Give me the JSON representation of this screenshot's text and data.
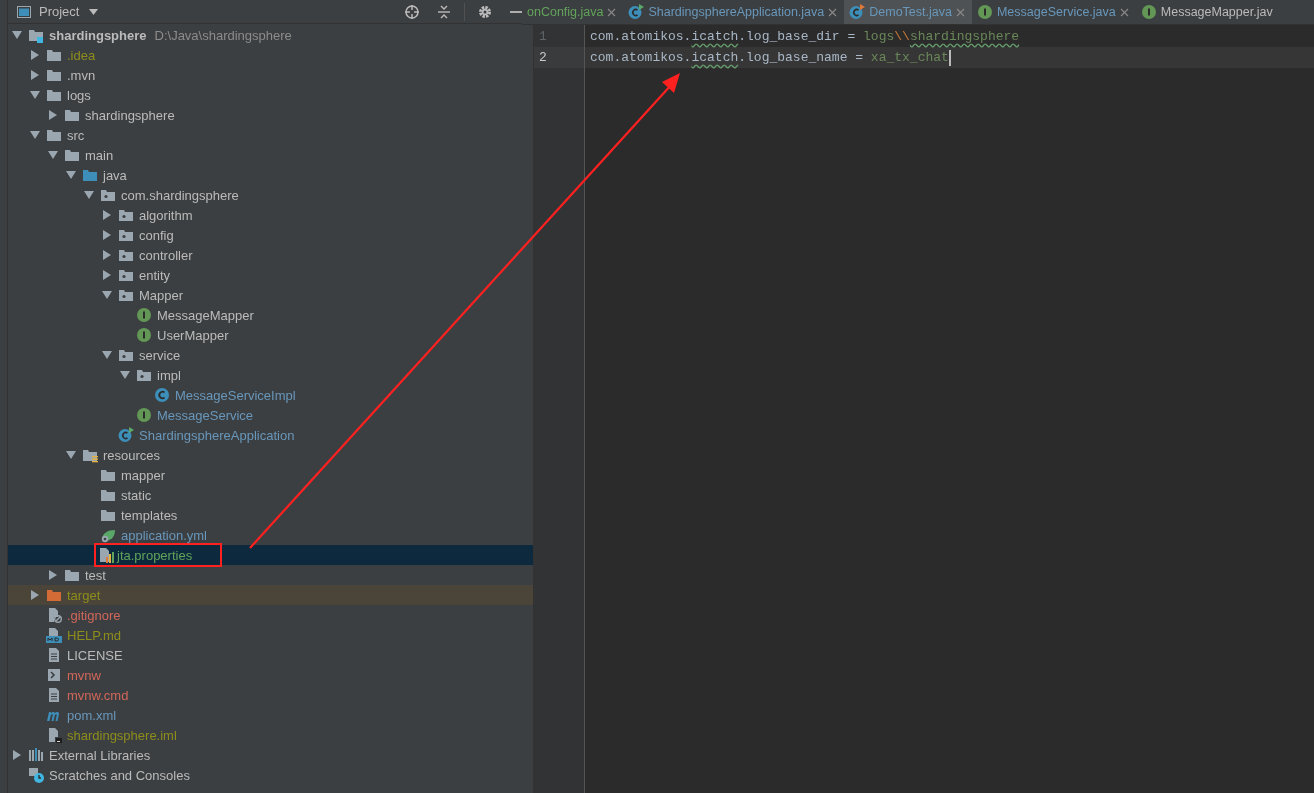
{
  "project_panel": {
    "title": "Project"
  },
  "tree": [
    {
      "name": "shardingsphere",
      "hint": "D:\\Java\\shardingsphere",
      "kind": "module",
      "color": "#bbbbbb",
      "expanded": true,
      "selected": false,
      "children": [
        {
          "name": ".idea",
          "kind": "folder",
          "color": "#8d8d1c",
          "expanded": false,
          "selected": false
        },
        {
          "name": ".mvn",
          "kind": "folder",
          "color": "#bbbbbb",
          "expanded": false,
          "selected": false
        },
        {
          "name": "logs",
          "kind": "folder",
          "color": "#bbbbbb",
          "expanded": true,
          "selected": false,
          "children": [
            {
              "name": "shardingsphere",
              "kind": "folder",
              "color": "#bbbbbb",
              "expanded": false,
              "selected": false
            }
          ]
        },
        {
          "name": "src",
          "kind": "folder",
          "color": "#bbbbbb",
          "expanded": true,
          "selected": false,
          "children": [
            {
              "name": "main",
              "kind": "folder",
              "color": "#bbbbbb",
              "expanded": true,
              "selected": false,
              "children": [
                {
                  "name": "java",
                  "kind": "source_root",
                  "color": "#bbbbbb",
                  "expanded": true,
                  "selected": false,
                  "children": [
                    {
                      "name": "com.shardingsphere",
                      "kind": "package",
                      "color": "#bbbbbb",
                      "expanded": true,
                      "selected": false,
                      "children": [
                        {
                          "name": "algorithm",
                          "kind": "package",
                          "color": "#bbbbbb",
                          "expanded": false,
                          "selected": false
                        },
                        {
                          "name": "config",
                          "kind": "package",
                          "color": "#bbbbbb",
                          "expanded": false,
                          "selected": false
                        },
                        {
                          "name": "controller",
                          "kind": "package",
                          "color": "#bbbbbb",
                          "expanded": false,
                          "selected": false
                        },
                        {
                          "name": "entity",
                          "kind": "package",
                          "color": "#bbbbbb",
                          "expanded": false,
                          "selected": false
                        },
                        {
                          "name": "Mapper",
                          "kind": "package",
                          "color": "#bbbbbb",
                          "expanded": true,
                          "selected": false,
                          "children": [
                            {
                              "name": "MessageMapper",
                              "kind": "interface",
                              "color": "#bbbbbb",
                              "selected": false
                            },
                            {
                              "name": "UserMapper",
                              "kind": "interface",
                              "color": "#bbbbbb",
                              "selected": false
                            }
                          ]
                        },
                        {
                          "name": "service",
                          "kind": "package",
                          "color": "#bbbbbb",
                          "expanded": true,
                          "selected": false,
                          "children": [
                            {
                              "name": "impl",
                              "kind": "package",
                              "color": "#bbbbbb",
                              "expanded": true,
                              "selected": false,
                              "children": [
                                {
                                  "name": "MessageServiceImpl",
                                  "kind": "class",
                                  "color": "#6897bb",
                                  "selected": false
                                }
                              ]
                            },
                            {
                              "name": "MessageService",
                              "kind": "interface",
                              "color": "#6897bb",
                              "selected": false
                            }
                          ]
                        },
                        {
                          "name": "ShardingsphereApplication",
                          "kind": "boot_class",
                          "color": "#6897bb",
                          "selected": false
                        }
                      ]
                    }
                  ]
                },
                {
                  "name": "resources",
                  "kind": "resources_root",
                  "color": "#bbbbbb",
                  "expanded": true,
                  "selected": false,
                  "children": [
                    {
                      "name": "mapper",
                      "kind": "folder",
                      "color": "#bbbbbb",
                      "selected": false
                    },
                    {
                      "name": "static",
                      "kind": "folder",
                      "color": "#bbbbbb",
                      "selected": false
                    },
                    {
                      "name": "templates",
                      "kind": "folder",
                      "color": "#bbbbbb",
                      "selected": false
                    },
                    {
                      "name": "application.yml",
                      "kind": "yml",
                      "color": "#6897bb",
                      "selected": false
                    },
                    {
                      "name": "jta.properties",
                      "kind": "properties",
                      "color": "#62a35a",
                      "selected": true,
                      "boxed": true
                    }
                  ]
                }
              ]
            },
            {
              "name": "test",
              "kind": "folder",
              "color": "#bbbbbb",
              "expanded": false,
              "selected": false
            }
          ]
        },
        {
          "name": "target",
          "kind": "excluded",
          "color": "#8d8d1c",
          "expanded": false,
          "selected": false
        },
        {
          "name": ".gitignore",
          "kind": "gitignore",
          "color": "#d1675a",
          "selected": false
        },
        {
          "name": "HELP.md",
          "kind": "markdown",
          "color": "#8d8d1c",
          "selected": false
        },
        {
          "name": "LICENSE",
          "kind": "text",
          "color": "#bbbbbb",
          "selected": false
        },
        {
          "name": "mvnw",
          "kind": "shell",
          "color": "#d1675a",
          "selected": false
        },
        {
          "name": "mvnw.cmd",
          "kind": "text",
          "color": "#d1675a",
          "selected": false
        },
        {
          "name": "pom.xml",
          "kind": "maven",
          "color": "#6897bb",
          "selected": false
        },
        {
          "name": "shardingsphere.iml",
          "kind": "iml",
          "color": "#8d8d1c",
          "selected": false
        }
      ]
    },
    {
      "name": "External Libraries",
      "kind": "libraries",
      "color": "#bbbbbb",
      "expanded": false,
      "selected": false
    },
    {
      "name": "Scratches and Consoles",
      "kind": "scratches",
      "color": "#bbbbbb",
      "selected": false
    }
  ],
  "editor_tabs": [
    {
      "label": "onConfig.java",
      "kind": "none",
      "color": "#62a35a",
      "selected": false,
      "closable": true
    },
    {
      "label": "ShardingsphereApplication.java",
      "kind": "boot_class",
      "color": "#6897bb",
      "selected": false,
      "closable": true
    },
    {
      "label": "DemoTest.java",
      "kind": "test_class",
      "color": "#6897bb",
      "selected": true,
      "closable": true
    },
    {
      "label": "MessageService.java",
      "kind": "interface",
      "color": "#6897bb",
      "selected": false,
      "closable": true
    },
    {
      "label": "MessageMapper.jav",
      "kind": "interface",
      "color": "#bbbbbb",
      "selected": false,
      "closable": false
    }
  ],
  "editor_lines": [
    {
      "number": "1",
      "current": false,
      "caret": false,
      "segments": [
        {
          "text": "com.atomikos.",
          "kind": "key"
        },
        {
          "text": "icatch",
          "kind": "key_typo"
        },
        {
          "text": ".log_base_dir = ",
          "kind": "key"
        },
        {
          "text": "logs",
          "kind": "value"
        },
        {
          "text": "\\\\",
          "kind": "escape"
        },
        {
          "text": "shardingsphere",
          "kind": "value_typo"
        }
      ]
    },
    {
      "number": "2",
      "current": true,
      "caret": true,
      "segments": [
        {
          "text": "com.atomikos.",
          "kind": "key"
        },
        {
          "text": "icatch",
          "kind": "key_typo"
        },
        {
          "text": ".log_base_name = ",
          "kind": "key"
        },
        {
          "text": "xa_tx_chat",
          "kind": "value"
        }
      ]
    }
  ],
  "annotation_arrow": true
}
